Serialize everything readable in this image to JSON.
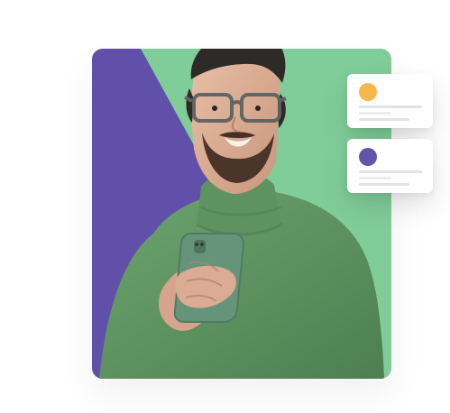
{
  "colors": {
    "background": "#ffffff",
    "accent_green": "#80cd99",
    "accent_purple": "#6150aa",
    "sweater_green": "#5f9261",
    "notification_orange": "#f6b84b",
    "notification_purple": "#6553a9",
    "skeleton_gray": "#e2e2e2"
  },
  "illustration": {
    "subject": "smiling-man-with-glasses-holding-smartphone",
    "clothing": "green-turtleneck-sweater",
    "device": "green-smartphone"
  },
  "notifications": [
    {
      "icon": "orange-status-dot",
      "color_key": "notification_orange"
    },
    {
      "icon": "purple-status-dot",
      "color_key": "notification_purple"
    }
  ]
}
